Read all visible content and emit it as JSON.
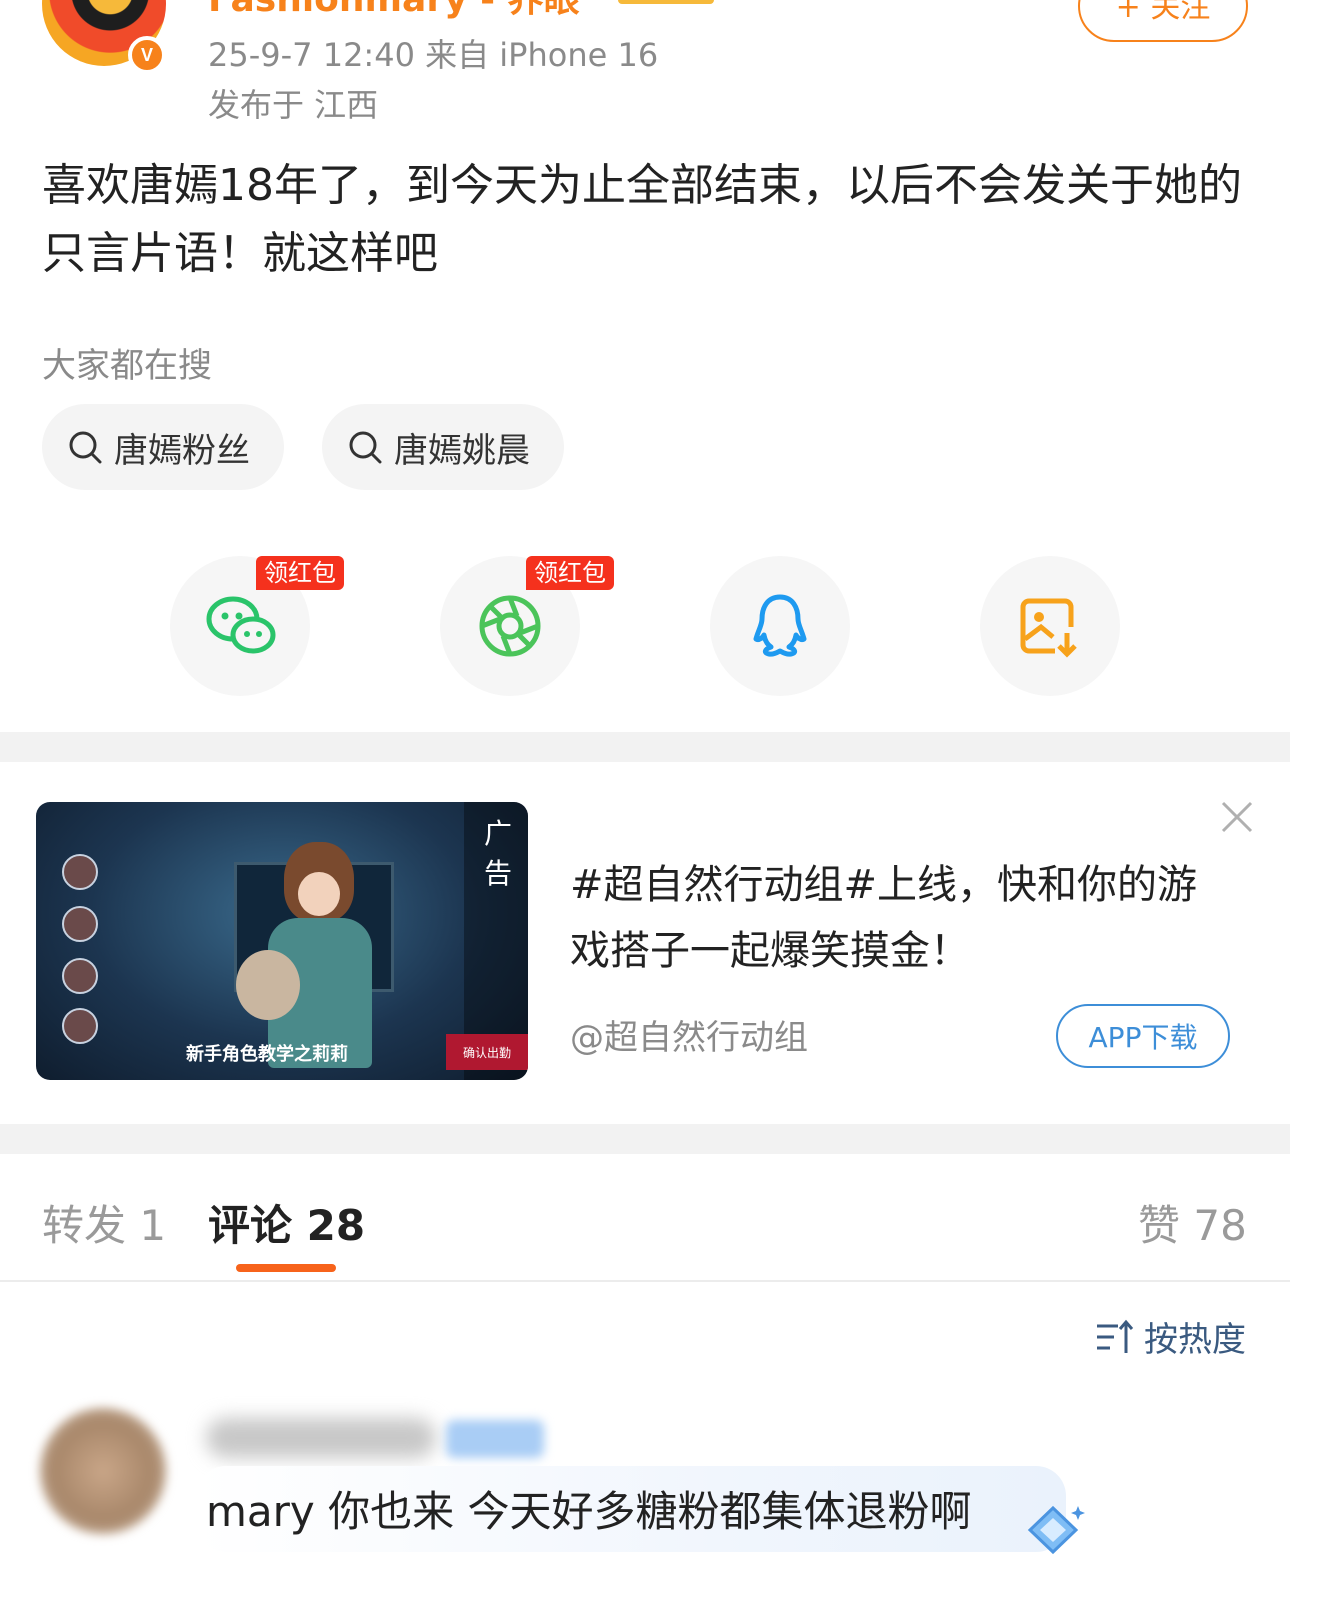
{
  "post": {
    "username": "Fashionmary - 养眼",
    "meta": "25-9-7 12:40  来自 iPhone 16",
    "location": "发布于 江西",
    "follow_label": "+ 关注",
    "text": "喜欢唐嫣18年了，到今天为止全部结束，以后不会发关于她的只言片语！就这样吧"
  },
  "search": {
    "title": "大家都在搜",
    "chips": [
      "唐嫣粉丝",
      "唐嫣姚晨"
    ]
  },
  "share": {
    "items": [
      {
        "icon": "wechat-icon",
        "badge": "领红包",
        "color": "#2ac46a"
      },
      {
        "icon": "moments-icon",
        "badge": "领红包",
        "color": "#4bc45a"
      },
      {
        "icon": "qq-icon",
        "badge": "",
        "color": "#1e9af0"
      },
      {
        "icon": "save-image-icon",
        "badge": "",
        "color": "#f7a21b"
      }
    ]
  },
  "ad": {
    "thumb_label": "广告",
    "thumb_caption": "新手角色教学之莉莉",
    "thumb_confirm": "确认出勤",
    "text": "#超自然行动组#上线，快和你的游戏搭子一起爆笑摸金！",
    "account": "@超自然行动组",
    "button_label": "APP下载"
  },
  "tabs": {
    "forward": "转发 1",
    "comment": "评论 28",
    "like": "赞 78"
  },
  "sort": {
    "label": "按热度"
  },
  "comment": {
    "text": "mary 你也来 今天好多糖粉都集体退粉啊"
  },
  "colors": {
    "accent": "#f7821b",
    "tab_active": "#f7631b",
    "link_blue": "#3d8ed8",
    "hongbao_red": "#f5311d"
  }
}
